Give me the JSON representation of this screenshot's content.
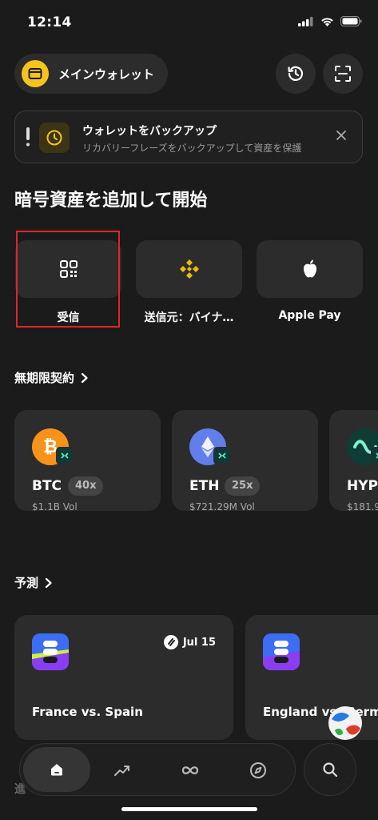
{
  "status_bar": {
    "time": "12:14"
  },
  "header": {
    "wallet_name": "メインウォレット"
  },
  "banner": {
    "title": "ウォレットをバックアップ",
    "subtitle": "リカバリーフレーズをバックアップして資産を保護"
  },
  "add_crypto": {
    "title": "暗号資産を追加して開始",
    "actions": [
      {
        "label": "受信",
        "icon": "qr-code-icon"
      },
      {
        "label": "送信元：バイナ…",
        "icon": "binance-icon"
      },
      {
        "label": "Apple Pay",
        "icon": "apple-icon"
      }
    ]
  },
  "perps": {
    "title": "無期限契約",
    "items": [
      {
        "symbol": "BTC",
        "leverage": "40x",
        "volume": "$1.1B Vol",
        "color": "#f7931a"
      },
      {
        "symbol": "ETH",
        "leverage": "25x",
        "volume": "$721.29M Vol",
        "color": "#627eea"
      },
      {
        "symbol": "HYP",
        "leverage": "",
        "volume": "$181.9",
        "color": "#0f3d36"
      }
    ]
  },
  "predictions": {
    "title": "予測",
    "items": [
      {
        "title": "France vs. Spain",
        "date": "Jul 15"
      },
      {
        "title": "England vs. Germ"
      }
    ]
  },
  "bottom_faded_label": "進",
  "colors": {
    "accent_yellow": "#f7c31c",
    "highlight_red": "#e0262a",
    "binance_yellow": "#f0b90b"
  }
}
